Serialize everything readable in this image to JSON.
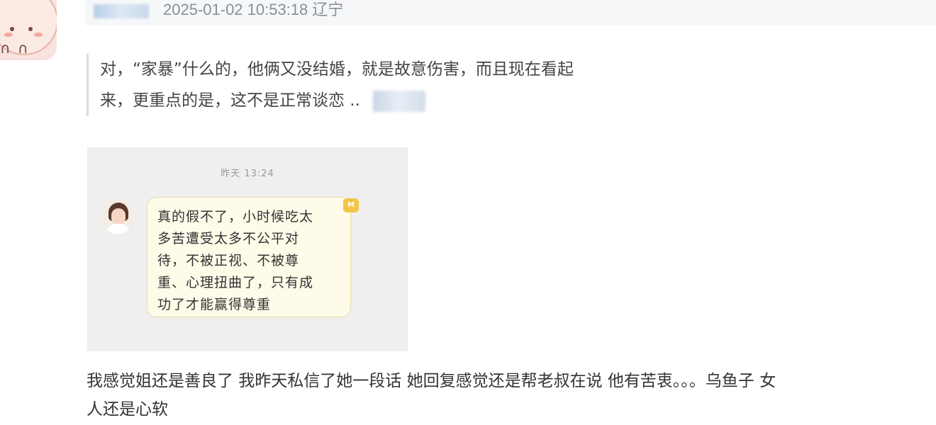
{
  "comment_header": {
    "timestamp_location": "2025-01-02 10:53:18 辽宁"
  },
  "quoted_comment": {
    "line1": "对，“家暴”什么的，他俩又没结婚，就是故意伤害，而且现在看起",
    "line2": "来，更重点的是，这不是正常谈恋 .."
  },
  "chat_screenshot": {
    "time": "昨天 13:24",
    "badge": "M",
    "message_lines": [
      "真的假不了，小时候吃太",
      "多苦遭受太多不公平对",
      "待，不被正视、不被尊",
      "重、心理扭曲了，只有成",
      "功了才能赢得尊重"
    ]
  },
  "reply": {
    "line1": "我感觉姐还是善良了 我昨天私信了她一段话 她回复感觉还是帮老叔在说 他有苦衷。。。乌鱼子 女",
    "line2": "人还是心软"
  },
  "icons": {
    "user_avatar": "cartoon-avatar-icon",
    "chat_avatar": "profile-photo-icon",
    "badge_icon": "vip-badge-icon"
  },
  "colors": {
    "meta_text": "#8a8f96",
    "quote_border": "#dcdcdc",
    "bubble_bg": "#fffbe9",
    "bubble_border": "#e7dcae",
    "badge": "#f4c44a"
  }
}
